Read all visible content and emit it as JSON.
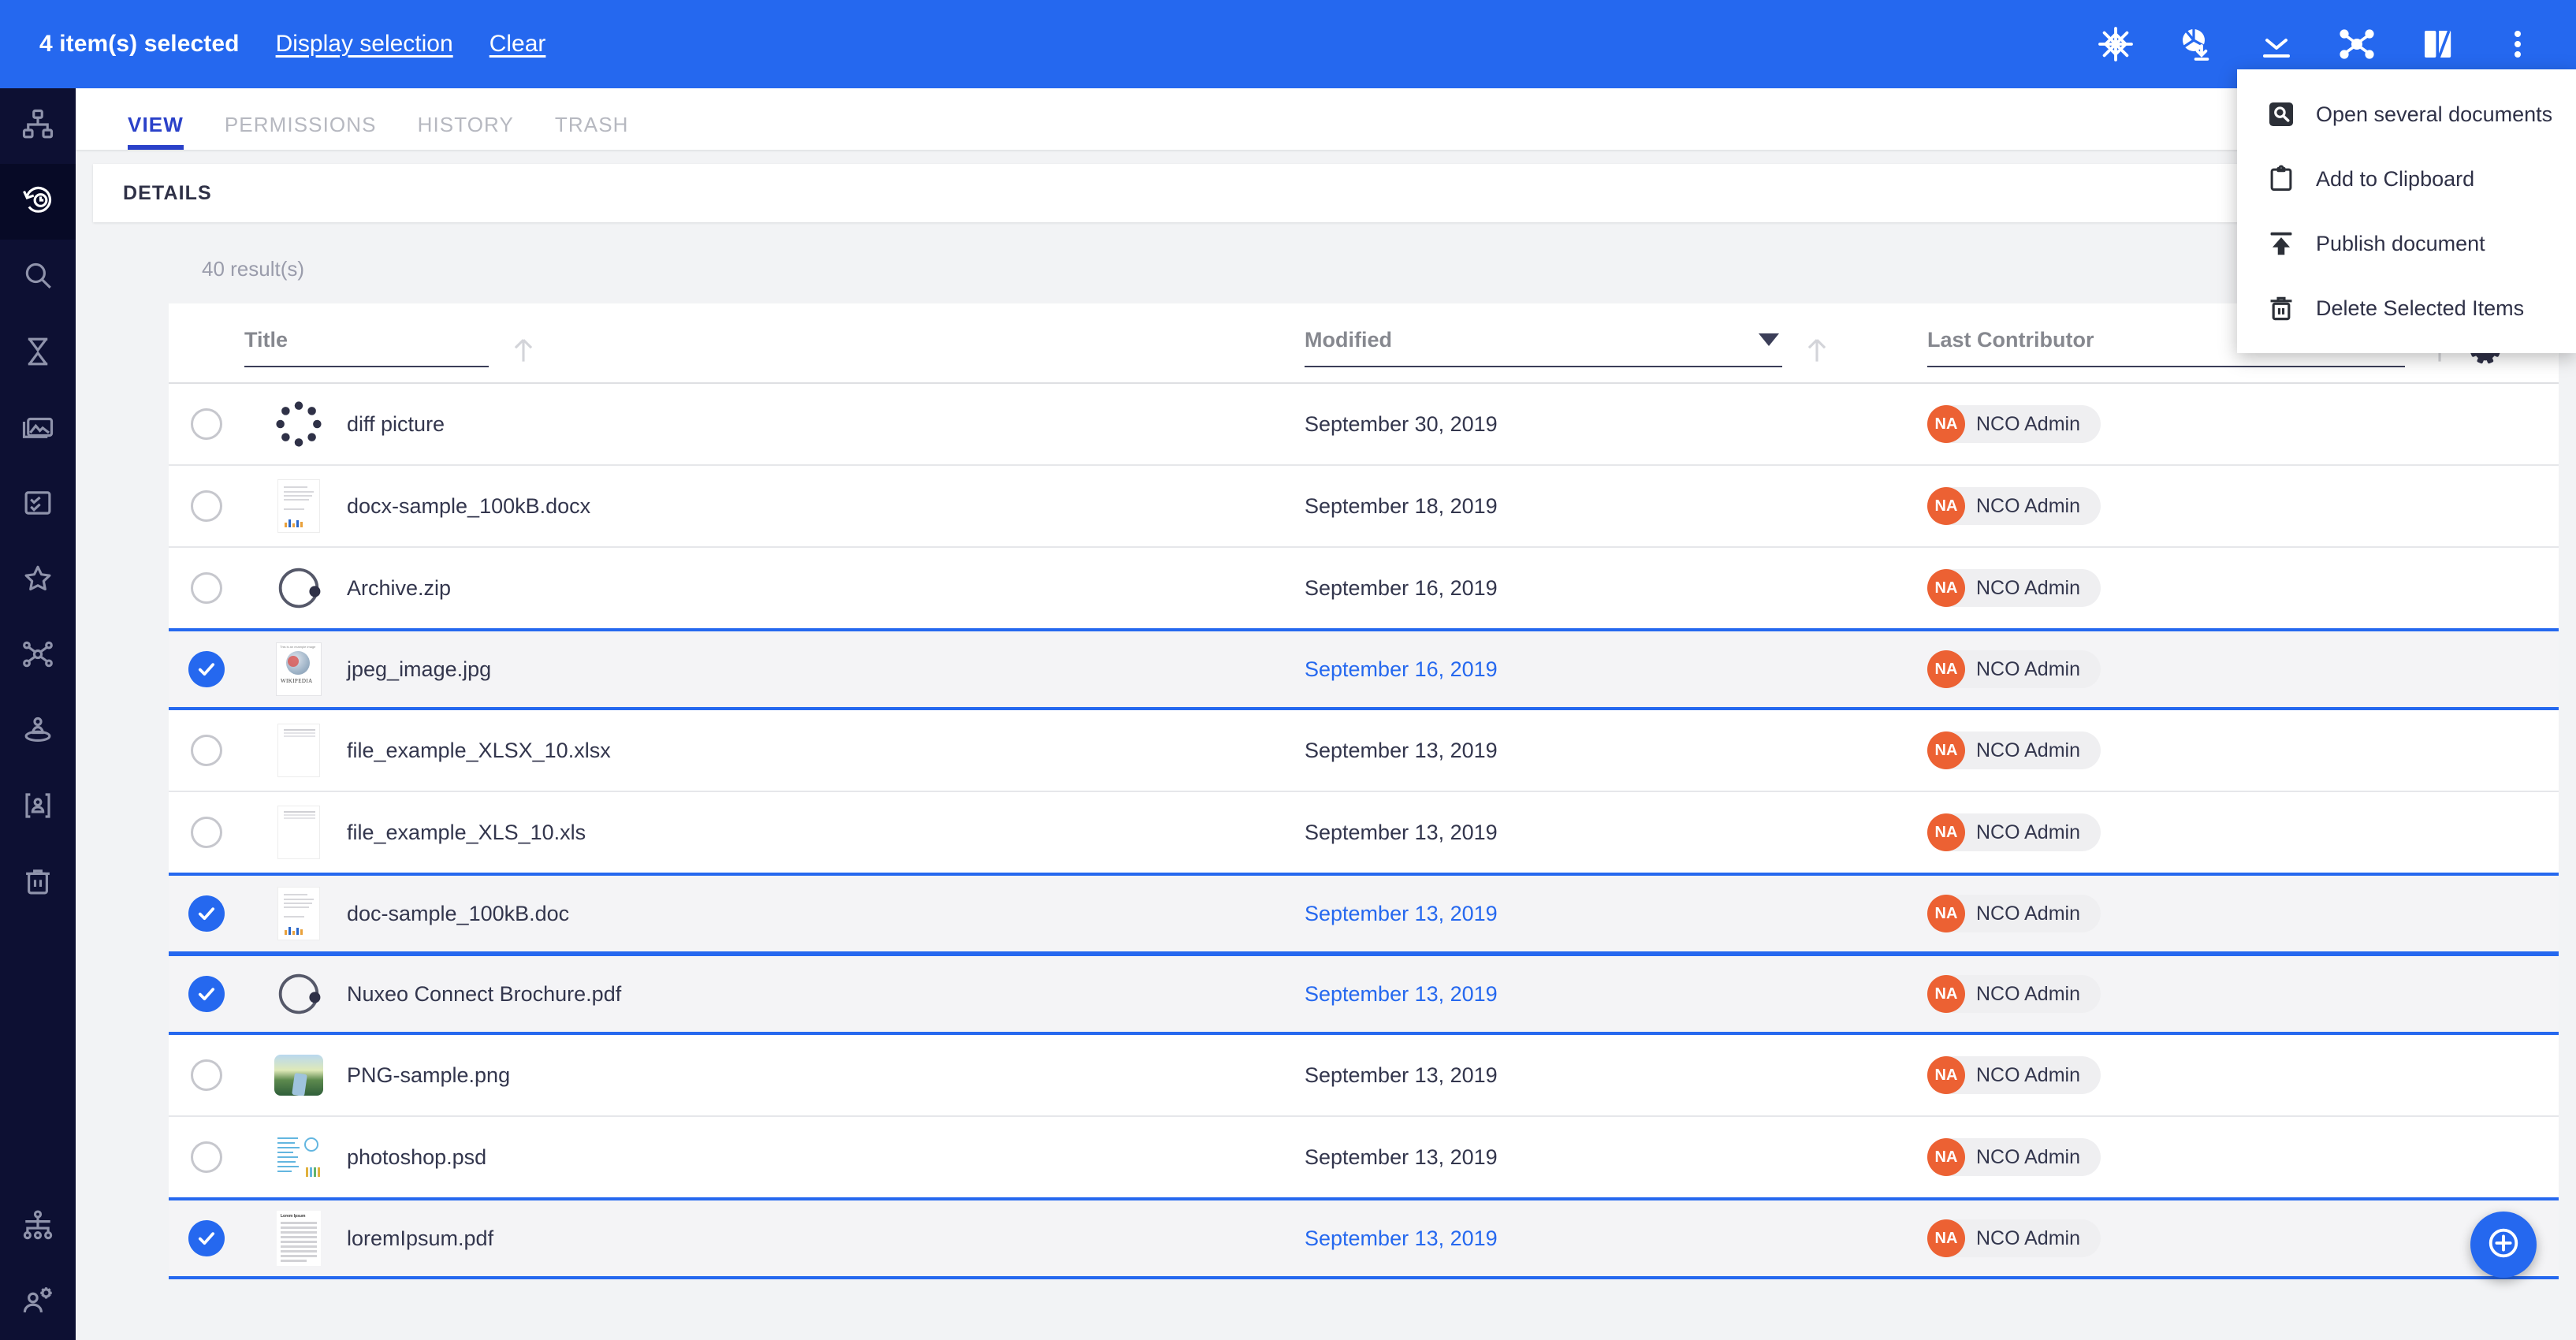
{
  "topbar": {
    "selection_text": "4 item(s) selected",
    "display_selection": "Display selection",
    "clear": "Clear",
    "actions": [
      {
        "name": "add-to-collection-icon",
        "title": "Add to collection"
      },
      {
        "name": "export-render-icon",
        "title": "Export rendition"
      },
      {
        "name": "download-icon",
        "title": "Download"
      },
      {
        "name": "share-icon",
        "title": "Share"
      },
      {
        "name": "compare-icon",
        "title": "Compare"
      },
      {
        "name": "more-vert-icon",
        "title": "More"
      }
    ]
  },
  "menu": {
    "items": [
      {
        "icon": "search-box-icon",
        "label": "Open several documents"
      },
      {
        "icon": "clipboard-icon",
        "label": "Add to Clipboard"
      },
      {
        "icon": "publish-upload-icon",
        "label": "Publish document"
      },
      {
        "icon": "trash-icon",
        "label": "Delete Selected Items"
      }
    ]
  },
  "sidebar": {
    "items": [
      {
        "name": "sitemap-icon",
        "label": "Browse",
        "active": false
      },
      {
        "name": "recent-history-icon",
        "label": "Recently viewed",
        "active": true
      },
      {
        "name": "search-icon",
        "label": "Search",
        "active": false
      },
      {
        "name": "hourglass-icon",
        "label": "Tasks",
        "active": false
      },
      {
        "name": "image-collection-icon",
        "label": "Collections",
        "active": false
      },
      {
        "name": "checklist-icon",
        "label": "Workflow",
        "active": false
      },
      {
        "name": "star-icon",
        "label": "Favorites",
        "active": false
      },
      {
        "name": "share-network-icon",
        "label": "Shared",
        "active": false
      },
      {
        "name": "user-location-icon",
        "label": "Local",
        "active": false
      },
      {
        "name": "id-card-icon",
        "label": "Directory",
        "active": false
      },
      {
        "name": "trash-icon",
        "label": "Trash",
        "active": false
      }
    ],
    "bottom_items": [
      {
        "name": "org-chart-icon",
        "label": "Users & Groups"
      },
      {
        "name": "user-settings-icon",
        "label": "Settings"
      }
    ]
  },
  "tabs": [
    {
      "label": "VIEW",
      "active": true
    },
    {
      "label": "PERMISSIONS",
      "active": false
    },
    {
      "label": "HISTORY",
      "active": false
    },
    {
      "label": "TRASH",
      "active": false
    }
  ],
  "details": {
    "title": "DETAILS",
    "result_count": "40 result(s)"
  },
  "table": {
    "columns": [
      {
        "key": "title",
        "label": "Title",
        "placeholder": "Title",
        "has_caret": false,
        "has_sort": true
      },
      {
        "key": "modified",
        "label": "Modified",
        "placeholder": "Modified",
        "has_caret": true,
        "has_sort": true
      },
      {
        "key": "contributor",
        "label": "Last Contributor",
        "placeholder": "Last Contributor",
        "has_caret": true,
        "has_sort": true
      }
    ],
    "settings_icon": "gear-icon",
    "rows": [
      {
        "title": "diff picture",
        "modified": "September 30, 2019",
        "contributor": "NCO Admin",
        "initials": "NA",
        "selected": false,
        "thumb": "spinner-dots"
      },
      {
        "title": "docx-sample_100kB.docx",
        "modified": "September 18, 2019",
        "contributor": "NCO Admin",
        "initials": "NA",
        "selected": false,
        "thumb": "doc-page"
      },
      {
        "title": "Archive.zip",
        "modified": "September 16, 2019",
        "contributor": "NCO Admin",
        "initials": "NA",
        "selected": false,
        "thumb": "spinner-arc"
      },
      {
        "title": "jpeg_image.jpg",
        "modified": "September 16, 2019",
        "contributor": "NCO Admin",
        "initials": "NA",
        "selected": true,
        "thumb": "wiki-image"
      },
      {
        "title": "file_example_XLSX_10.xlsx",
        "modified": "September 13, 2019",
        "contributor": "NCO Admin",
        "initials": "NA",
        "selected": false,
        "thumb": "sheet-page"
      },
      {
        "title": "file_example_XLS_10.xls",
        "modified": "September 13, 2019",
        "contributor": "NCO Admin",
        "initials": "NA",
        "selected": false,
        "thumb": "sheet-page"
      },
      {
        "title": "doc-sample_100kB.doc",
        "modified": "September 13, 2019",
        "contributor": "NCO Admin",
        "initials": "NA",
        "selected": true,
        "thumb": "doc-page"
      },
      {
        "title": "Nuxeo Connect Brochure.pdf",
        "modified": "September 13, 2019",
        "contributor": "NCO Admin",
        "initials": "NA",
        "selected": true,
        "thumb": "spinner-arc"
      },
      {
        "title": "PNG-sample.png",
        "modified": "September 13, 2019",
        "contributor": "NCO Admin",
        "initials": "NA",
        "selected": false,
        "thumb": "photo"
      },
      {
        "title": "photoshop.psd",
        "modified": "September 13, 2019",
        "contributor": "NCO Admin",
        "initials": "NA",
        "selected": false,
        "thumb": "psd"
      },
      {
        "title": "loremIpsum.pdf",
        "modified": "September 13, 2019",
        "contributor": "NCO Admin",
        "initials": "NA",
        "selected": true,
        "thumb": "lorem"
      }
    ]
  },
  "fab": {
    "icon": "add-circle-icon",
    "label": "Create"
  },
  "colors": {
    "accent": "#2568ef",
    "sidebar_bg": "#0d1033",
    "tab_active": "#2a41c9",
    "avatar": "#ec6133",
    "text": "#33364d"
  }
}
